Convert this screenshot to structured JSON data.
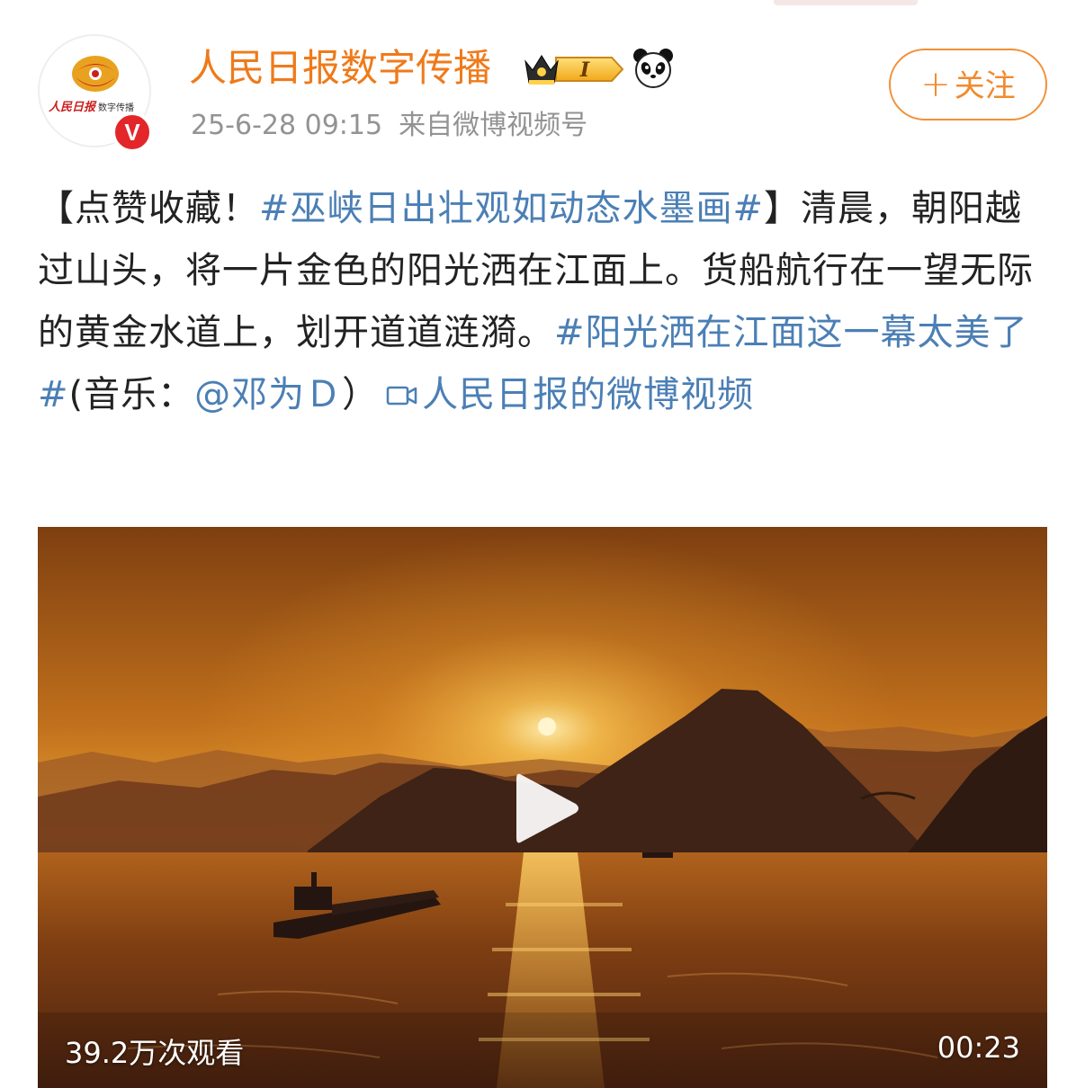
{
  "post": {
    "author": {
      "name": "人民日报数字传播",
      "avatar_text_brush": "人民日报",
      "avatar_text_small": "数字传播",
      "verified_mark": "V"
    },
    "badges": {
      "crown_level": "I",
      "icons": [
        "crown-badge-icon",
        "panda-icon"
      ]
    },
    "timestamp": "25-6-28 09:15",
    "source_label": "来自",
    "source_name": "微博视频号",
    "follow_button": {
      "plus": "+",
      "label": "关注"
    },
    "text": {
      "part1": "【点赞收藏！",
      "topic1": "#巫峡日出壮观如动态水墨画#",
      "part2": "】清晨，朝阳越过山头，将一片金色的阳光洒在江面上。货船航行在一望无际的黄金水道上，划开道道涟漪。",
      "topic2": "#阳光洒在江面这一幕太美了#",
      "part3": "(音乐：",
      "mention": "@邓为Ｄ",
      "part4": "）",
      "video_link_icon": "video-camera-icon",
      "video_link": "人民日报的微博视频"
    },
    "video": {
      "views": "39.2万次观看",
      "duration": "00:23",
      "colors": {
        "sky_top": "#8c4712",
        "sky_glow": "#f2b13a",
        "sun": "#fff4c8",
        "water": "#6e3410",
        "mountains": "#3a2216"
      }
    }
  },
  "colors": {
    "username": "#ef7a1a",
    "link": "#4b7fb5",
    "meta": "#939393",
    "follow_border": "#f29037",
    "verified": "#e3262a"
  }
}
